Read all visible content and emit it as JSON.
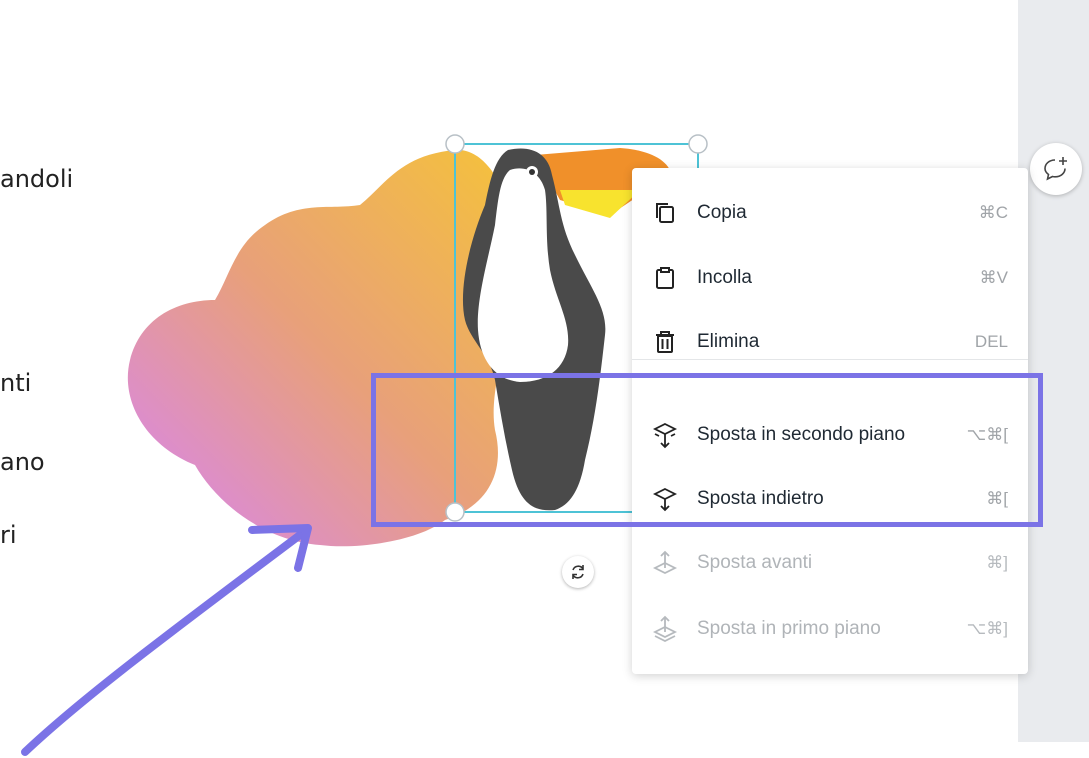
{
  "background_text": [
    {
      "text": "andoli"
    },
    {
      "text": "nti"
    },
    {
      "text": "ano"
    },
    {
      "text": "ri"
    }
  ],
  "context_menu": {
    "items": [
      {
        "label": "Copia",
        "shortcut": "⌘C",
        "icon": "copy-icon",
        "enabled": true
      },
      {
        "label": "Incolla",
        "shortcut": "⌘V",
        "icon": "paste-icon",
        "enabled": true
      },
      {
        "label": "Elimina",
        "shortcut": "DEL",
        "icon": "trash-icon",
        "enabled": true
      },
      {
        "label": "Sposta in secondo piano",
        "shortcut": "⌥⌘[",
        "icon": "send-to-back-icon",
        "enabled": true
      },
      {
        "label": "Sposta indietro",
        "shortcut": "⌘[",
        "icon": "send-backward-icon",
        "enabled": true
      },
      {
        "label": "Sposta avanti",
        "shortcut": "⌘]",
        "icon": "bring-forward-icon",
        "enabled": false
      },
      {
        "label": "Sposta in primo piano",
        "shortcut": "⌥⌘]",
        "icon": "bring-to-front-icon",
        "enabled": false
      }
    ]
  },
  "colors": {
    "highlight": "#7b73e6",
    "selection": "#4dc3d6",
    "blob_gradient_start": "#f5c23a",
    "blob_gradient_end": "#d784f5",
    "side_panel": "#e9ebee"
  }
}
